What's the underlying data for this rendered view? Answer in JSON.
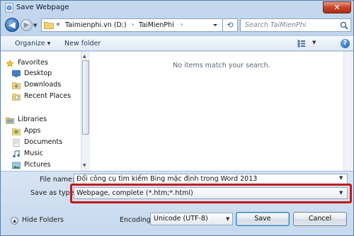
{
  "window": {
    "title": "Save Webpage",
    "close_label": "✕",
    "accent_color": "#c4442b"
  },
  "nav": {
    "back_label": "◀",
    "forward_label": "▶",
    "history_label": "▼",
    "address_overflow": "«",
    "breadcrumb": [
      "Taimienphi.vn (D:)",
      "TaiMienPhi"
    ],
    "crumb_sep": "›",
    "refresh_label": "⟲",
    "search_placeholder": "Search TaiMienPhi"
  },
  "toolbar": {
    "organize_label": "Organize ▾",
    "new_folder_label": "New folder",
    "help_label": "?"
  },
  "navpane": {
    "items": [
      {
        "label": "Favorites",
        "icon": "star-icon"
      },
      {
        "label": "Desktop",
        "icon": "desktop-icon"
      },
      {
        "label": "Downloads",
        "icon": "downloads-icon"
      },
      {
        "label": "Recent Places",
        "icon": "recent-places-icon"
      },
      {
        "label": "Libraries",
        "icon": "libraries-icon"
      },
      {
        "label": "Apps",
        "icon": "apps-icon"
      },
      {
        "label": "Documents",
        "icon": "documents-icon"
      },
      {
        "label": "Music",
        "icon": "music-icon"
      },
      {
        "label": "Pictures",
        "icon": "pictures-icon"
      }
    ]
  },
  "content": {
    "empty_message": "No items match your search."
  },
  "form": {
    "filename_label": "File name:",
    "filename_value": "Đổi công cụ tìm kiếm Bing mặc định trong Word 2013",
    "savetype_label": "Save as type:",
    "savetype_value": "Webpage, complete (*.htm;*.html)",
    "encoding_label": "Encoding:",
    "encoding_value": "Unicode (UTF-8)",
    "save_label": "Save",
    "cancel_label": "Cancel",
    "hide_folders_label": "Hide Folders",
    "highlight_color": "#c11a1a"
  }
}
